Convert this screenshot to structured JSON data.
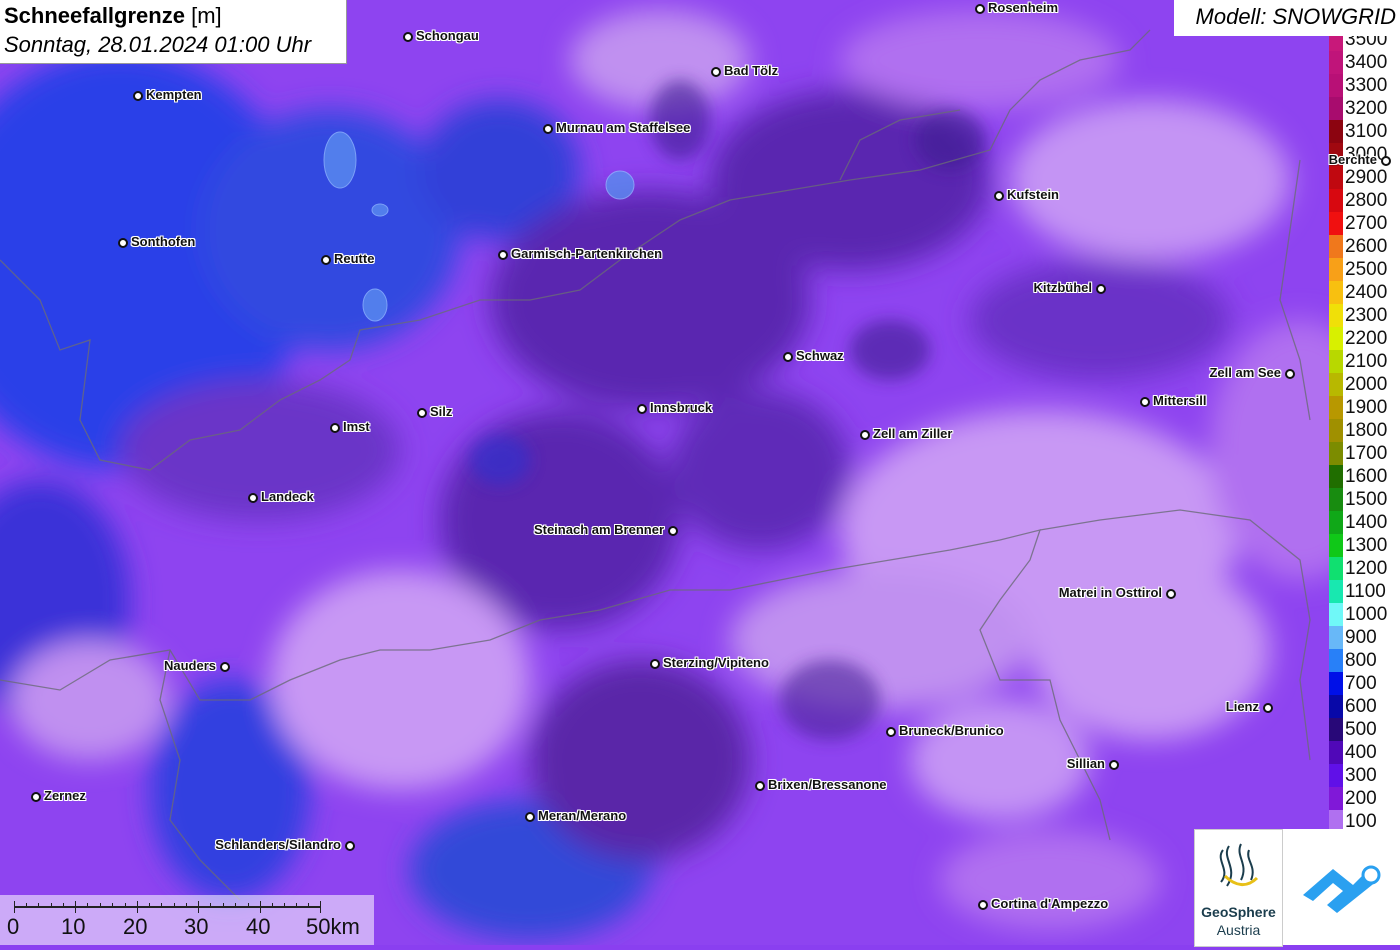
{
  "header": {
    "title_bold": "Schneefallgrenze",
    "title_unit": "[m]",
    "datetime": "Sonntag, 28.01.2024 01:00 Uhr"
  },
  "model": {
    "label": "Modell: SNOWGRID"
  },
  "legend": {
    "items": [
      {
        "label": "3500",
        "color": "#c8187a"
      },
      {
        "label": "3400",
        "color": "#c0147a"
      },
      {
        "label": "3300",
        "color": "#b81076"
      },
      {
        "label": "3200",
        "color": "#a80c6e"
      },
      {
        "label": "3100",
        "color": "#8c0410"
      },
      {
        "label": "3000",
        "color": "#a00810"
      },
      {
        "label": "2900",
        "color": "#c00810"
      },
      {
        "label": "2800",
        "color": "#d80810"
      },
      {
        "label": "2700",
        "color": "#f01010"
      },
      {
        "label": "2600",
        "color": "#f0781c"
      },
      {
        "label": "2500",
        "color": "#f8a018"
      },
      {
        "label": "2400",
        "color": "#f8c010"
      },
      {
        "label": "2300",
        "color": "#f0e008"
      },
      {
        "label": "2200",
        "color": "#d8f000"
      },
      {
        "label": "2100",
        "color": "#b8d800"
      },
      {
        "label": "2000",
        "color": "#b8b800"
      },
      {
        "label": "1900",
        "color": "#b89800"
      },
      {
        "label": "1800",
        "color": "#a09000"
      },
      {
        "label": "1700",
        "color": "#7c8c00"
      },
      {
        "label": "1600",
        "color": "#206e00"
      },
      {
        "label": "1500",
        "color": "#188c10"
      },
      {
        "label": "1400",
        "color": "#10a818"
      },
      {
        "label": "1300",
        "color": "#10c818"
      },
      {
        "label": "1200",
        "color": "#10e070"
      },
      {
        "label": "1100",
        "color": "#18e8b0"
      },
      {
        "label": "1000",
        "color": "#70f8f8"
      },
      {
        "label": "900",
        "color": "#68b8f8"
      },
      {
        "label": "800",
        "color": "#2880f8"
      },
      {
        "label": "700",
        "color": "#0010e8"
      },
      {
        "label": "600",
        "color": "#0808a8"
      },
      {
        "label": "500",
        "color": "#280878"
      },
      {
        "label": "400",
        "color": "#5008b8"
      },
      {
        "label": "300",
        "color": "#6010e8"
      },
      {
        "label": "200",
        "color": "#8018d8"
      },
      {
        "label": "100",
        "color": "#b070f0"
      }
    ]
  },
  "cities": [
    {
      "name": "Rosenheim",
      "label": "Rosenheim"
    },
    {
      "name": "Schongau",
      "label": "Schongau"
    },
    {
      "name": "Bad Tölz",
      "label": "Bad Tölz"
    },
    {
      "name": "Kempten",
      "label": "Kempten"
    },
    {
      "name": "Murnau",
      "label": "Murnau am Staffelsee"
    },
    {
      "name": "Berchtesgaden",
      "label": "Berchte"
    },
    {
      "name": "Kufstein",
      "label": "Kufstein"
    },
    {
      "name": "Sonthofen",
      "label": "Sonthofen"
    },
    {
      "name": "Reutte",
      "label": "Reutte"
    },
    {
      "name": "Garmisch",
      "label": "Garmisch-Partenkirchen"
    },
    {
      "name": "Kitzbühel",
      "label": "Kitzbühel"
    },
    {
      "name": "Schwaz",
      "label": "Schwaz"
    },
    {
      "name": "Zell am See",
      "label": "Zell am See"
    },
    {
      "name": "Mittersill",
      "label": "Mittersill"
    },
    {
      "name": "Silz",
      "label": "Silz"
    },
    {
      "name": "Innsbruck",
      "label": "Innsbruck"
    },
    {
      "name": "Imst",
      "label": "Imst"
    },
    {
      "name": "Zell am Ziller",
      "label": "Zell am Ziller"
    },
    {
      "name": "Landeck",
      "label": "Landeck"
    },
    {
      "name": "Steinach",
      "label": "Steinach am Brenner"
    },
    {
      "name": "Matrei",
      "label": "Matrei in Osttirol"
    },
    {
      "name": "Nauders",
      "label": "Nauders"
    },
    {
      "name": "Sterzing",
      "label": "Sterzing/Vipiteno"
    },
    {
      "name": "Lienz",
      "label": "Lienz"
    },
    {
      "name": "Bruneck",
      "label": "Bruneck/Brunico"
    },
    {
      "name": "Sillian",
      "label": "Sillian"
    },
    {
      "name": "Brixen",
      "label": "Brixen/Bressanone"
    },
    {
      "name": "Zernez",
      "label": "Zernez"
    },
    {
      "name": "Meran",
      "label": "Meran/Merano"
    },
    {
      "name": "Schlanders",
      "label": "Schlanders/Silandro"
    },
    {
      "name": "Cortina",
      "label": "Cortina d'Ampezzo"
    }
  ],
  "scale": {
    "labels": [
      "0",
      "10",
      "20",
      "30",
      "40",
      "50km"
    ]
  },
  "logos": {
    "geosphere_name": "GeoSphere",
    "geosphere_sub": "Austria"
  }
}
